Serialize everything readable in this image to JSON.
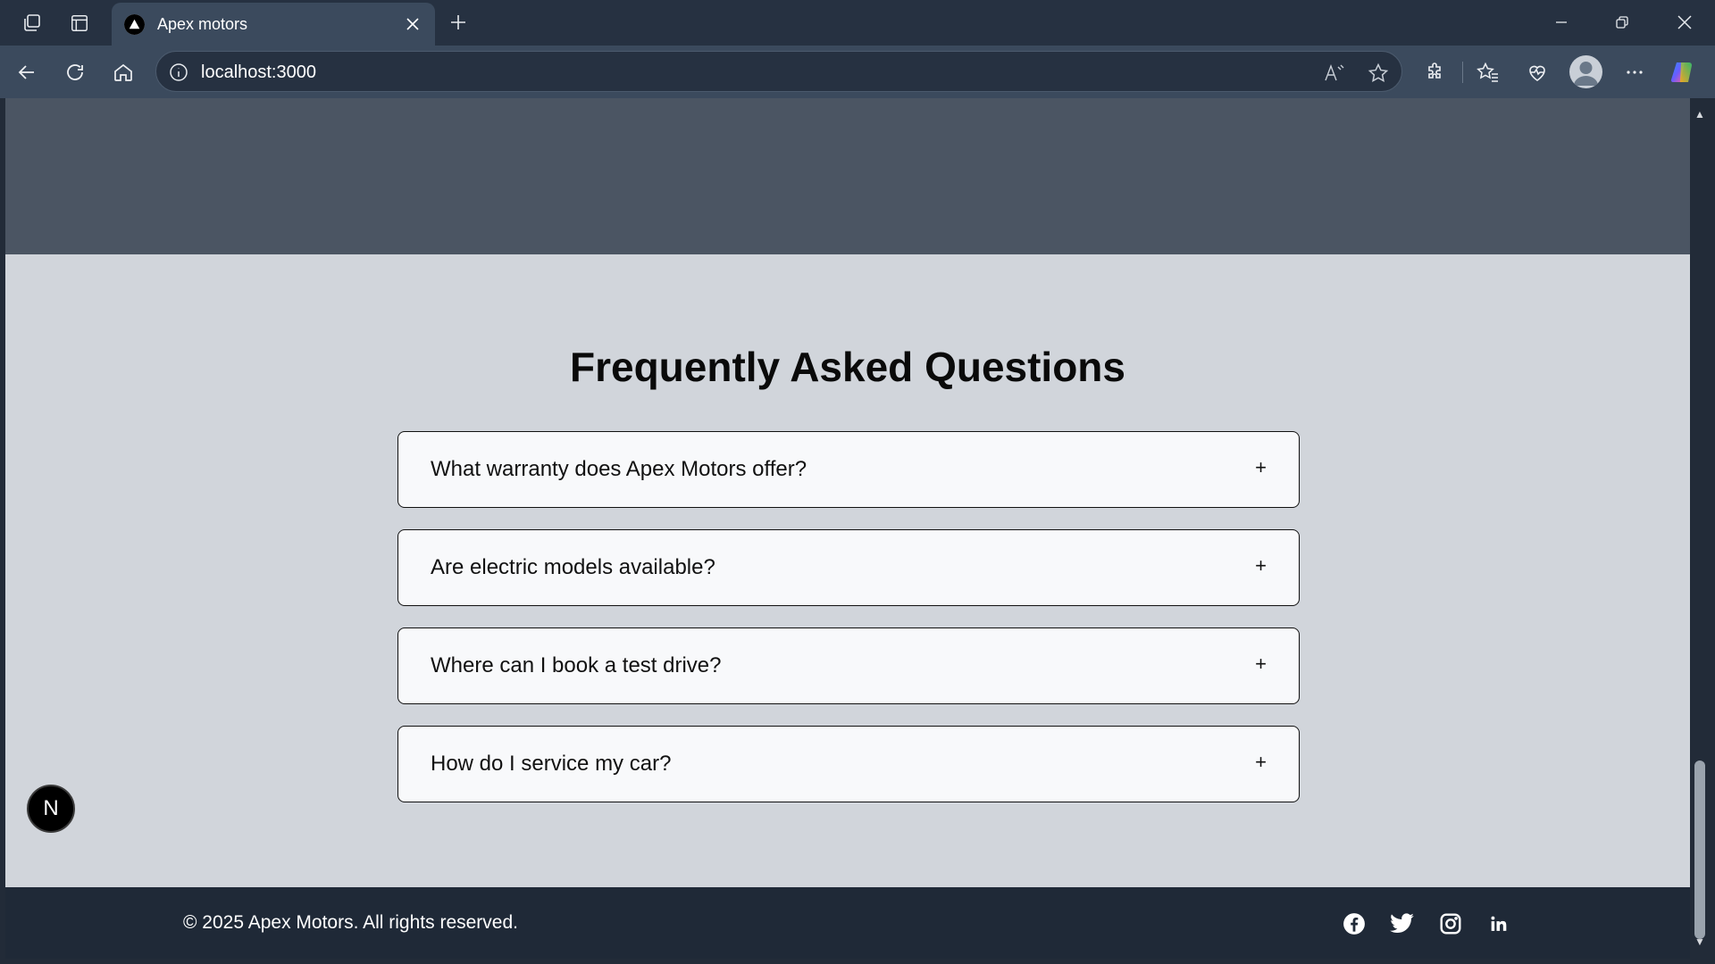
{
  "browser": {
    "tab_title": "Apex motors",
    "url": "localhost:3000",
    "accent": "#3b4a5d"
  },
  "page": {
    "faq_title": "Frequently Asked Questions",
    "faq_items": [
      {
        "question": "What warranty does Apex Motors offer?",
        "toggle": "+"
      },
      {
        "question": "Are electric models available?",
        "toggle": "+"
      },
      {
        "question": "Where can I book a test drive?",
        "toggle": "+"
      },
      {
        "question": "How do I service my car?",
        "toggle": "+"
      }
    ],
    "footer": {
      "copyright": "© 2025 Apex Motors. All rights reserved.",
      "social": [
        "facebook-icon",
        "twitter-icon",
        "instagram-icon",
        "linkedin-icon"
      ]
    },
    "dev_badge": "N"
  }
}
